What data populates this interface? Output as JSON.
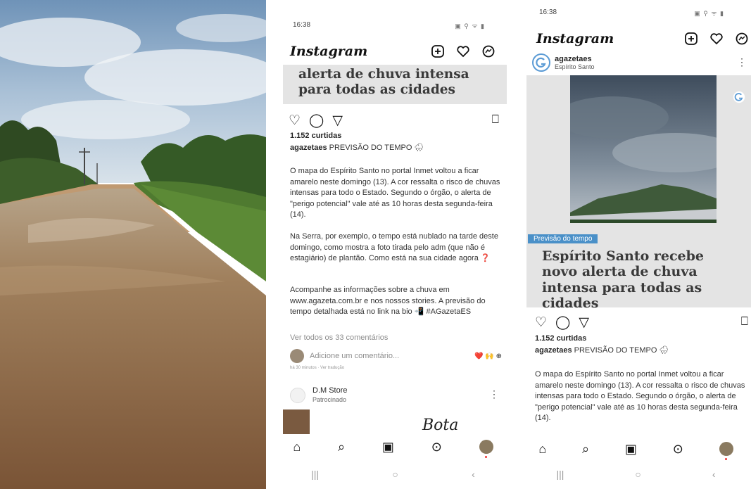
{
  "status": {
    "time": "16:38",
    "icons": "▣ ⚲ ᯤ ▮"
  },
  "app": {
    "name": "Instagram"
  },
  "icons": {
    "new_post": "new-post-icon",
    "heart": "heart-icon",
    "messenger": "messenger-icon"
  },
  "post": {
    "account": "agazetaes",
    "location": "Espírito Santo",
    "tag": "Previsão do tempo",
    "headline_partial": "alerta de chuva intensa para todas as cidades",
    "headline_full": "Espírito Santo recebe novo alerta de chuva intensa para todas as cidades",
    "likes": "1.152 curtidas",
    "caption_lead": "PREVISÃO DO TEMPO 🌧",
    "paragraph1": "O mapa do Espírito Santo no portal Inmet voltou a ficar amarelo neste domingo (13). A cor ressalta o risco de chuvas intensas para todo o Estado. Segundo o órgão, o alerta de \"perigo potencial\" vale até as 10 horas desta segunda-feira (14).",
    "paragraph2": "Na Serra, por exemplo, o tempo está nublado na tarde deste domingo, como mostra a foto tirada pelo adm (que não é estagiário) de plantão. Como está na sua cidade agora ❓",
    "paragraph3": "Acompanhe as informações sobre a chuva em www.agazeta.com.br e nos nossos stories. A previsão do tempo detalhada está no link na bio 📲 #AGazetaES",
    "view_comments": "Ver todos os 33 comentários",
    "add_comment_placeholder": "Adicione um comentário...",
    "comment_emojis": "❤️ 🙌 ⊕",
    "time_ago": "há 30 minutos · Ver tradução"
  },
  "sponsored": {
    "name": "D.M Store",
    "label": "Patrocinado",
    "preview_text": "Bota"
  },
  "bottom_nav": [
    "home-icon",
    "search-icon",
    "reels-icon",
    "shop-icon",
    "profile-icon"
  ],
  "system_nav": {
    "recents": "|||",
    "home": "○",
    "back": "‹"
  },
  "colors": {
    "tag_bg": "#4a90c8",
    "headline_bg": "#e4e4e4",
    "hashtag": "#00376b"
  }
}
